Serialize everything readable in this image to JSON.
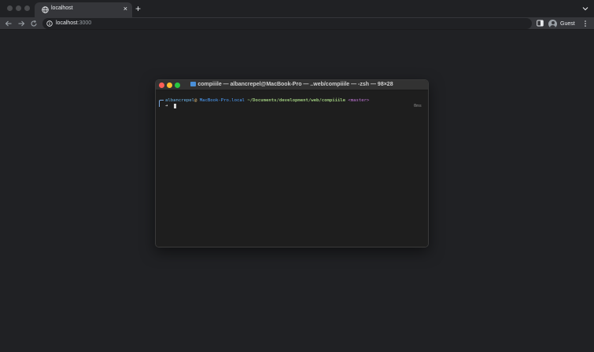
{
  "browser": {
    "tab": {
      "title": "localhost"
    },
    "url": {
      "host": "localhost",
      "port": ":3000"
    },
    "profile": {
      "name": "Guest"
    }
  },
  "terminal": {
    "title": "compiiile — albancrepel@MacBook-Pro — ..web/compiiile — -zsh — 98×28",
    "prompt": {
      "user": "albancrepel",
      "at": "@",
      "host": "MacBook-Pro.local",
      "path": "~/Documents/development/web/compiiile",
      "branch": "<master>",
      "arrow": "➜",
      "elapsed": "0ms"
    }
  },
  "colors": {
    "chrome_bg": "#202124",
    "toolbar_bg": "#35363a",
    "terminal_bg": "#1e1e1e",
    "close_red": "#ff5f57",
    "minimize_yellow": "#febc2e",
    "zoom_green": "#28c840"
  }
}
